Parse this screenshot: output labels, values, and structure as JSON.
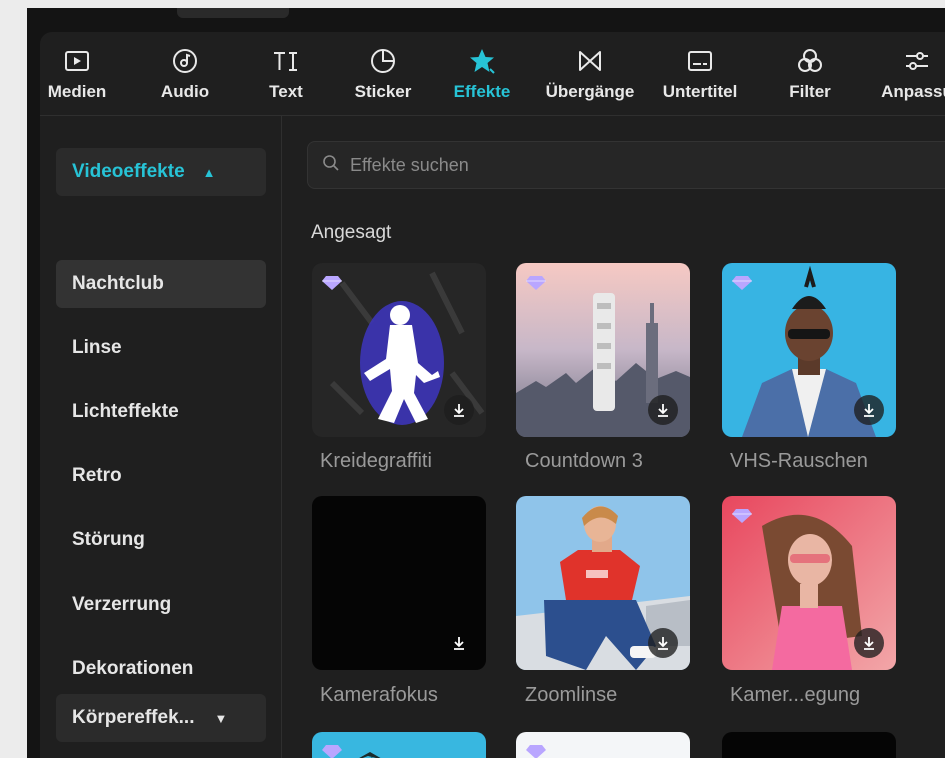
{
  "toolbar": {
    "tools": [
      {
        "label": "Medien",
        "icon": "media-icon"
      },
      {
        "label": "Audio",
        "icon": "audio-icon"
      },
      {
        "label": "Text",
        "icon": "text-icon"
      },
      {
        "label": "Sticker",
        "icon": "sticker-icon"
      },
      {
        "label": "Effekte",
        "icon": "effects-star-icon",
        "active": true
      },
      {
        "label": "Übergänge",
        "icon": "transitions-icon"
      },
      {
        "label": "Untertitel",
        "icon": "subtitles-icon"
      },
      {
        "label": "Filter",
        "icon": "filter-icon"
      },
      {
        "label": "Anpassu",
        "icon": "adjust-icon"
      }
    ]
  },
  "sidebar": {
    "category": "Videoeffekte",
    "items": [
      "Nachtclub",
      "Linse",
      "Lichteffekte",
      "Retro",
      "Störung",
      "Verzerrung",
      "Dekorationen"
    ],
    "selected": "Nachtclub",
    "footer_category": "Körpereffek..."
  },
  "search": {
    "placeholder": "Effekte suchen"
  },
  "section": {
    "title": "Angesagt"
  },
  "effects": [
    {
      "name": "Kreidegraffiti",
      "premium": true
    },
    {
      "name": "Countdown 3",
      "premium": true
    },
    {
      "name": "VHS-Rauschen",
      "premium": true
    },
    {
      "name": "Kamerafokus",
      "premium": false
    },
    {
      "name": "Zoomlinse",
      "premium": false
    },
    {
      "name": "Kamer...egung",
      "premium": true
    }
  ],
  "colors": {
    "accent": "#27c3d6",
    "premium_gem": "#b9a6ff",
    "panel": "#1f1f1f"
  }
}
